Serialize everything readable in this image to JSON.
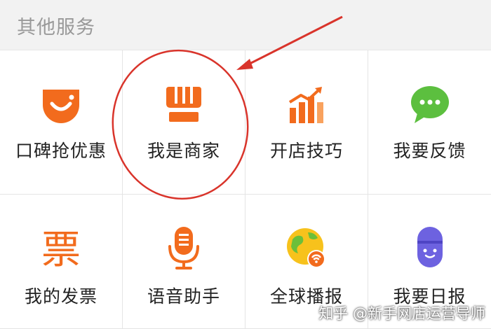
{
  "header": {
    "title": "其他服务"
  },
  "services": [
    {
      "label": "口碑抢优惠",
      "icon": "koubei-discount-icon"
    },
    {
      "label": "我是商家",
      "icon": "merchant-store-icon"
    },
    {
      "label": "开店技巧",
      "icon": "growth-chart-icon"
    },
    {
      "label": "我要反馈",
      "icon": "feedback-chat-icon"
    },
    {
      "label": "我的发票",
      "icon": "invoice-piao-icon"
    },
    {
      "label": "语音助手",
      "icon": "microphone-icon"
    },
    {
      "label": "全球播报",
      "icon": "globe-broadcast-icon"
    },
    {
      "label": "我要日报",
      "icon": "daily-report-icon"
    }
  ],
  "icons": {
    "invoice_glyph": "票"
  },
  "colors": {
    "orange": "#f26b1d",
    "green": "#5cbf3f",
    "yellow": "#f7c21c",
    "purple": "#6d62e0",
    "annotation_red": "#d9342b"
  },
  "watermark": "知乎 @新手网店运营导师"
}
